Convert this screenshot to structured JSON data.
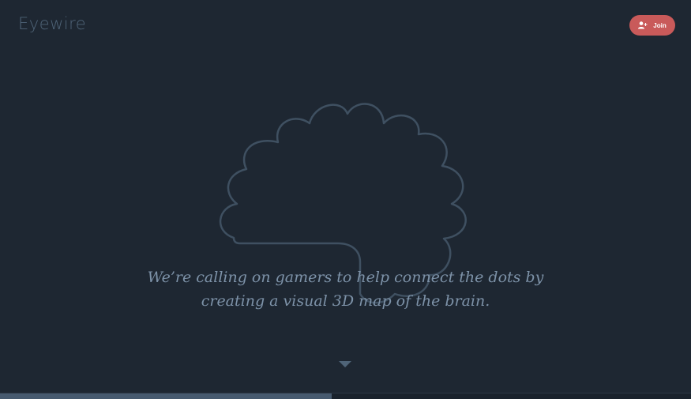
{
  "header": {
    "logo_text": "Eyewire",
    "join_label": "Join",
    "join_icon": "user-plus-icon",
    "join_color": "#c95a5a"
  },
  "hero": {
    "illustration": "brain-outline",
    "tagline_line1": "We’re calling on gamers to help connect the dots by",
    "tagline_line2": "creating a visual 3D map of the brain."
  },
  "scroll_indicator": {
    "icon": "chevron-down-icon"
  },
  "progress": {
    "fraction": 0.48
  },
  "colors": {
    "background": "#1e2732",
    "accent": "#c95a5a",
    "muted": "#4f6478"
  }
}
